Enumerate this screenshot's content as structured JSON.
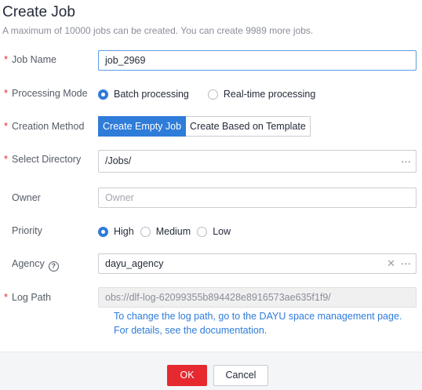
{
  "dialog": {
    "title": "Create Job",
    "subtitle": "A maximum of 10000 jobs can be created. You can create 9989 more jobs."
  },
  "form": {
    "required_mark": "*",
    "job_name": {
      "label": "Job Name",
      "value": "job_2969"
    },
    "processing_mode": {
      "label": "Processing Mode",
      "options": [
        "Batch processing",
        "Real-time processing"
      ],
      "selected": "Batch processing"
    },
    "creation_method": {
      "label": "Creation Method",
      "options": [
        "Create Empty Job",
        "Create Based on Template"
      ],
      "selected": "Create Empty Job"
    },
    "select_directory": {
      "label": "Select Directory",
      "value": "/Jobs/",
      "browse_glyph": "···"
    },
    "owner": {
      "label": "Owner",
      "placeholder": "Owner"
    },
    "priority": {
      "label": "Priority",
      "options": [
        "High",
        "Medium",
        "Low"
      ],
      "selected": "High"
    },
    "agency": {
      "label": "Agency",
      "value": "dayu_agency",
      "clear_glyph": "✕",
      "browse_glyph": "···",
      "help_glyph": "?"
    },
    "log_path": {
      "label": "Log Path",
      "value": "obs://dlf-log-62099355b894428e8916573ae635f1f9/",
      "hint_line1": "To change the log path, go to the DAYU space management page.",
      "hint_line2": "For details, see the documentation."
    }
  },
  "footer": {
    "ok_label": "OK",
    "cancel_label": "Cancel"
  },
  "colors": {
    "accent": "#2f7cd9",
    "danger": "#e5292f",
    "required": "#e5292f"
  }
}
